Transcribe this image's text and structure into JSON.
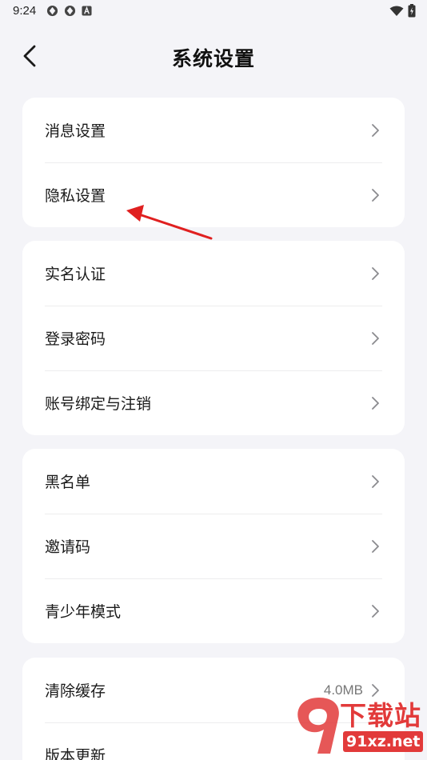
{
  "status_bar": {
    "time": "9:24"
  },
  "nav": {
    "title": "系统设置"
  },
  "groups": [
    {
      "items": [
        {
          "label": "消息设置"
        },
        {
          "label": "隐私设置"
        }
      ]
    },
    {
      "items": [
        {
          "label": "实名认证"
        },
        {
          "label": "登录密码"
        },
        {
          "label": "账号绑定与注销"
        }
      ]
    },
    {
      "items": [
        {
          "label": "黑名单"
        },
        {
          "label": "邀请码"
        },
        {
          "label": "青少年模式"
        }
      ]
    },
    {
      "items": [
        {
          "label": "清除缓存",
          "value": "4.0MB"
        },
        {
          "label": "版本更新"
        }
      ]
    }
  ],
  "watermark": {
    "brand": "下载站",
    "domain": "91xz.net"
  },
  "colors": {
    "background": "#f4f4f8",
    "card": "#ffffff",
    "annotation_arrow": "#e02020",
    "watermark": "#e23a3a"
  }
}
